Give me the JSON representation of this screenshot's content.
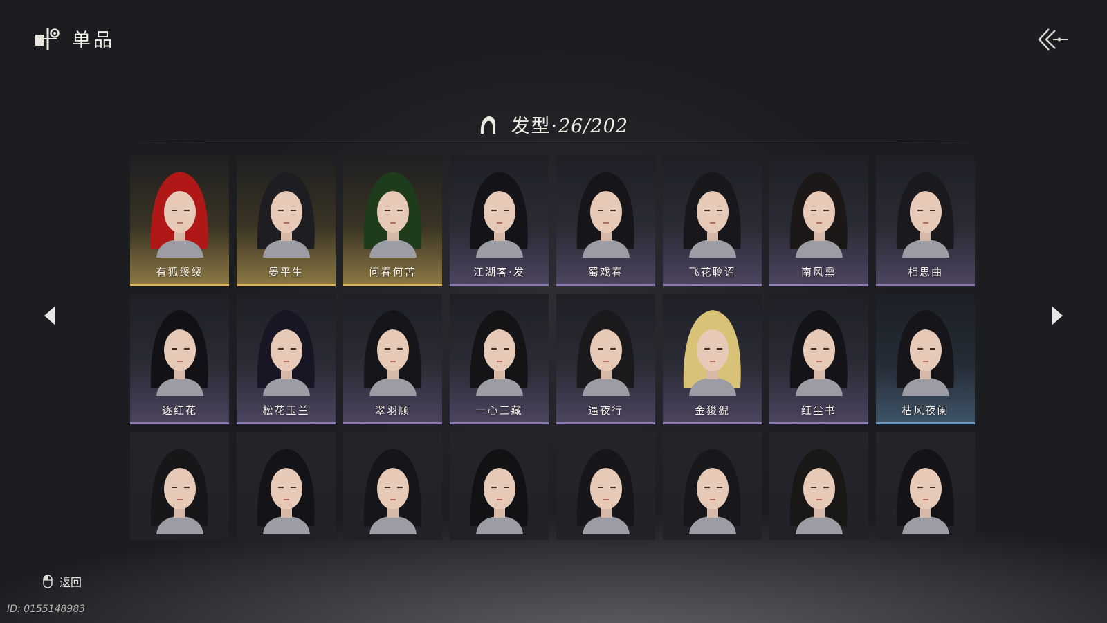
{
  "header": {
    "title": "单品",
    "icon": "collection-icon",
    "back_icon": "double-chevron-left-icon"
  },
  "section": {
    "icon": "hairstyle-icon",
    "label": "发型",
    "separator": "·",
    "count": "26/202"
  },
  "rows": [
    [
      {
        "name": "有狐绥绥",
        "tier": "gold",
        "hair": "#b01818"
      },
      {
        "name": "晏平生",
        "tier": "gold",
        "hair": "#1e1e22"
      },
      {
        "name": "问春何苦",
        "tier": "gold",
        "hair": "#1e3c1c"
      },
      {
        "name": "江湖客·发",
        "tier": "purple",
        "hair": "#141418"
      },
      {
        "name": "蜀戏春",
        "tier": "purple",
        "hair": "#16161a"
      },
      {
        "name": "飞花聆诏",
        "tier": "purple",
        "hair": "#18181c"
      },
      {
        "name": "南风熏",
        "tier": "purple",
        "hair": "#1c1818"
      },
      {
        "name": "相思曲",
        "tier": "purple",
        "hair": "#1a1a1e"
      }
    ],
    [
      {
        "name": "逐红花",
        "tier": "purple",
        "hair": "#121216"
      },
      {
        "name": "松花玉兰",
        "tier": "purple",
        "hair": "#181624"
      },
      {
        "name": "翠羽顾",
        "tier": "purple",
        "hair": "#16161a"
      },
      {
        "name": "一心三藏",
        "tier": "purple",
        "hair": "#141416"
      },
      {
        "name": "逼夜行",
        "tier": "purple",
        "hair": "#1a1a1c"
      },
      {
        "name": "金狻猊",
        "tier": "purple",
        "hair": "#d8c278"
      },
      {
        "name": "红尘书",
        "tier": "purple",
        "hair": "#141418"
      },
      {
        "name": "枯风夜阑",
        "tier": "blue",
        "hair": "#16161a"
      }
    ],
    [
      {
        "name": "",
        "tier": "plain",
        "hair": "#17171a"
      },
      {
        "name": "",
        "tier": "plain",
        "hair": "#141418"
      },
      {
        "name": "",
        "tier": "plain",
        "hair": "#16161a"
      },
      {
        "name": "",
        "tier": "plain",
        "hair": "#121215"
      },
      {
        "name": "",
        "tier": "plain",
        "hair": "#17171b"
      },
      {
        "name": "",
        "tier": "plain",
        "hair": "#18181c"
      },
      {
        "name": "",
        "tier": "plain",
        "hair": "#1a1816"
      },
      {
        "name": "",
        "tier": "plain",
        "hair": "#141418"
      }
    ]
  ],
  "nav": {
    "prev_icon": "caret-left-icon",
    "next_icon": "caret-right-icon"
  },
  "footer": {
    "back_label": "返回",
    "mouse_icon": "mouse-icon",
    "player_id": "ID: 0155148983"
  },
  "colors": {
    "gold": "#d8b25a",
    "purple": "#8c7ab0",
    "blue": "#6b98c0"
  }
}
